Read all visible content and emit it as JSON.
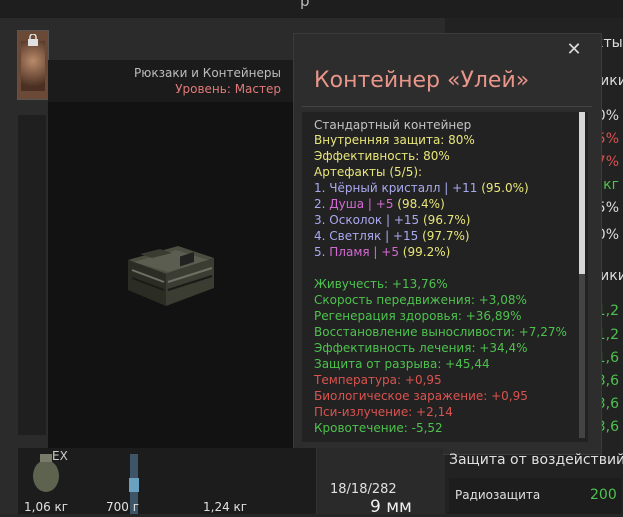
{
  "background": {
    "top_title_fragment": "р",
    "right_panel": {
      "header_1": "кты",
      "header_2": "тики",
      "header_3": "тики",
      "values_top": [
        "00%",
        "35%",
        "37%",
        "5 кг",
        "5%",
        "0%"
      ],
      "values_bottom": [
        "1,2",
        "1,2",
        "1,6",
        "3,6",
        "3,6",
        "3,6"
      ],
      "protection_title": "Защита от воздействий",
      "protection_row_label": "Радиозащита",
      "protection_row_value": "200"
    },
    "bottom_slots": [
      {
        "weight": "1,06 кг",
        "tag": "EX"
      },
      {
        "weight": "700 г"
      },
      {
        "weight": "1,24 кг"
      }
    ],
    "ammo_count": "18/18/282",
    "ammo_caliber": "9 мм"
  },
  "preview": {
    "category": "Рюкзаки и Контейнеры",
    "level_label": "Уровень: Мастер"
  },
  "tooltip": {
    "title": "Контейнер «Улей»",
    "close_icon": "close-icon",
    "type": "Стандартный контейнер",
    "internal_protection": "Внутренняя защита: 80%",
    "efficiency": "Эффективность: 80%",
    "artifacts_header": "Артефакты (5/5):",
    "artifacts": [
      {
        "index": "1.",
        "name": "Чёрный кристалл",
        "sep": " | ",
        "level": "+11",
        "percent": " (95.0%)",
        "color": "#a9a9f0"
      },
      {
        "index": "2.",
        "name": "Душа",
        "sep": " | ",
        "level": "+5",
        "percent": " (98.4%)",
        "color": "#d36bd3"
      },
      {
        "index": "3.",
        "name": "Осколок",
        "sep": " | ",
        "level": "+15",
        "percent": " (96.7%)",
        "color": "#a9a9f0"
      },
      {
        "index": "4.",
        "name": "Светляк",
        "sep": " | ",
        "level": "+15",
        "percent": " (97.7%)",
        "color": "#a9a9f0"
      },
      {
        "index": "5.",
        "name": "Пламя",
        "sep": " | ",
        "level": "+5",
        "percent": " (99.2%)",
        "color": "#d36bd3"
      }
    ],
    "stats": [
      {
        "text": "Живучесть: +13,76%",
        "color": "green"
      },
      {
        "text": "Скорость передвижения: +3,08%",
        "color": "green"
      },
      {
        "text": "Регенерация здоровья: +36,89%",
        "color": "green"
      },
      {
        "text": "Восстановление выносливости: +7,27%",
        "color": "green"
      },
      {
        "text": "Эффективность лечения: +34,4%",
        "color": "green"
      },
      {
        "text": "Защита от разрыва: +45,44",
        "color": "green"
      },
      {
        "text": "Температура: +0,95",
        "color": "red"
      },
      {
        "text": "Биологическое заражение: +0,95",
        "color": "red"
      },
      {
        "text": "Пси-излучение: +2,14",
        "color": "red"
      },
      {
        "text": "Кровотечение: -5,52",
        "color": "green"
      }
    ]
  }
}
